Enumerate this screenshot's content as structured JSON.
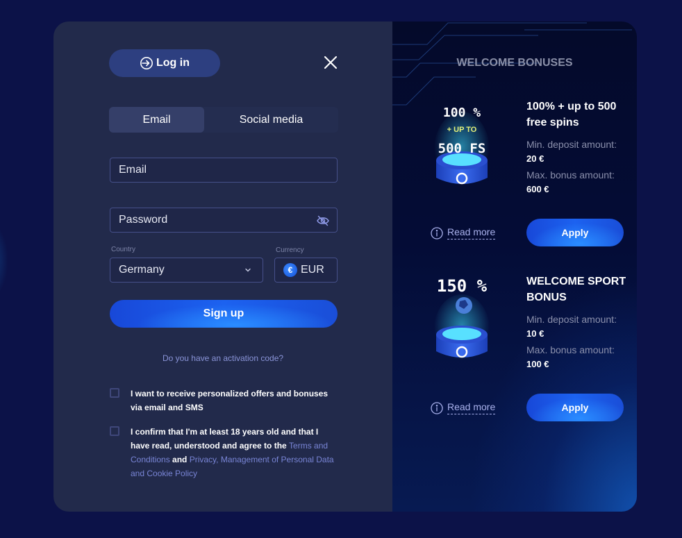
{
  "header": {
    "login_label": "Log in",
    "login_icon": "login-arrow-icon",
    "close_icon": "close-icon"
  },
  "tabs": [
    {
      "label": "Email",
      "active": true
    },
    {
      "label": "Social media",
      "active": false
    }
  ],
  "form": {
    "email": {
      "placeholder": "Email",
      "value": ""
    },
    "password": {
      "placeholder": "Password",
      "value": "",
      "icon": "eye-slash-icon"
    },
    "country": {
      "label": "Country",
      "value": "Germany"
    },
    "currency": {
      "label": "Currency",
      "value": "EUR",
      "symbol": "€"
    },
    "signup_label": "Sign up",
    "activation_link": "Do you have an activation code?"
  },
  "consents": [
    {
      "text": "I want to receive personalized offers and bonuses via email and SMS",
      "checked": false
    },
    {
      "text_1": "I confirm that I'm at least 18 years old and that I have read, understood and agree to the ",
      "link_1": "Terms and Conditions",
      "text_2": " and ",
      "link_2": "Privacy, Management of Personal Data and Cookie Policy",
      "checked": false
    }
  ],
  "bonuses": {
    "title": "WELCOME BONUSES",
    "items": [
      {
        "image_line1": "100 %",
        "image_line2": "+ UP TO",
        "image_line3": "500 FS",
        "title": "100% + up to 500 free spins",
        "min_label": "Min. deposit amount:",
        "min_value": "20 €",
        "max_label": "Max. bonus amount:",
        "max_value": "600 €",
        "read_more": "Read more",
        "apply": "Apply"
      },
      {
        "image_line1": "150 %",
        "title": "WELCOME SPORT BONUS",
        "min_label": "Min. deposit amount:",
        "min_value": "10 €",
        "max_label": "Max. bonus amount:",
        "max_value": "100 €",
        "read_more": "Read more",
        "apply": "Apply"
      }
    ]
  },
  "colors": {
    "page_bg": "#0c1248",
    "panel_bg": "#222a4b",
    "accent_blue": "#1c62f0",
    "link": "#7985d6"
  }
}
